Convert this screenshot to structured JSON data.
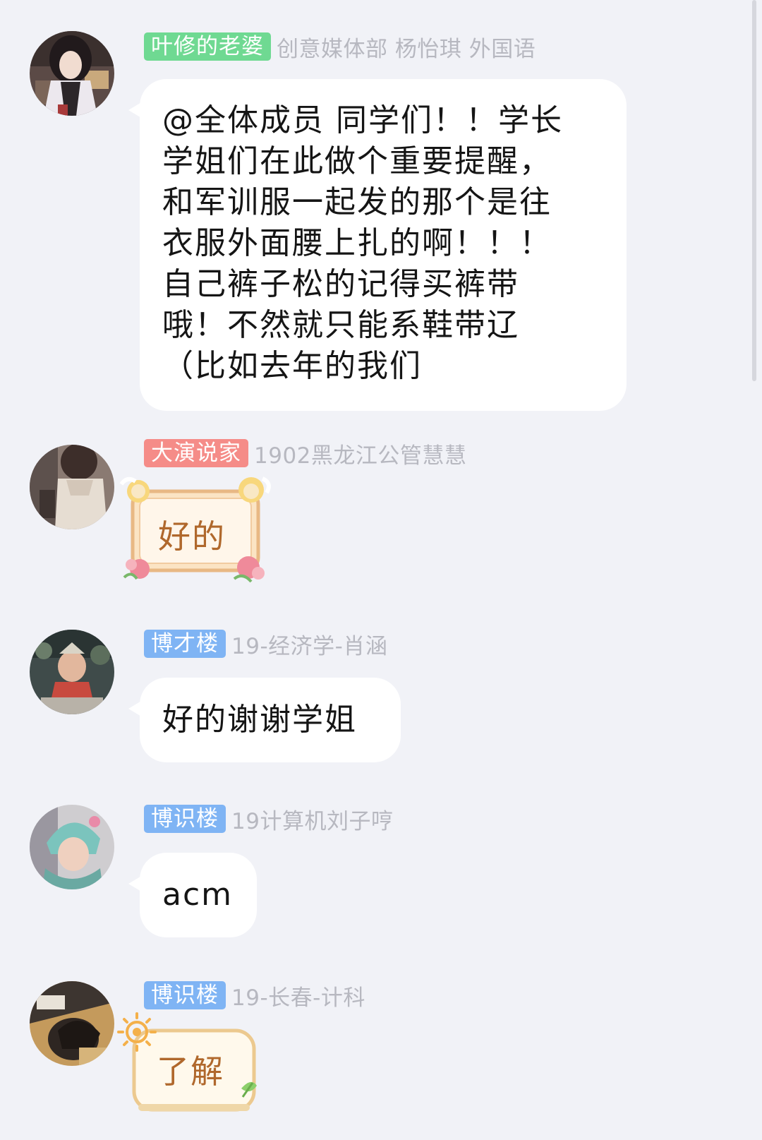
{
  "messages": [
    {
      "badge": "叶修的老婆",
      "badge_color": "#6fd992",
      "sender": "创意媒体部 杨怡琪 外国语",
      "lines": [
        "@全体成员 同学们！！学长",
        "学姐们在此做个重要提醒，",
        "和军训服一起发的那个是往",
        "衣服外面腰上扎的啊！！！",
        "自己裤子松的记得买裤带",
        "哦！不然就只能系鞋带辽",
        "（比如去年的我们"
      ]
    },
    {
      "badge": "大演说家",
      "badge_color": "#f58c88",
      "sender": "1902黑龙江公管慧慧",
      "sticker_text": "好的"
    },
    {
      "badge": "博才楼",
      "badge_color": "#7fb4f4",
      "sender": "19-经济学-肖涵",
      "text": "好的谢谢学姐"
    },
    {
      "badge": "博识楼",
      "badge_color": "#7fb4f4",
      "sender": "19计算机刘子哼",
      "text": "acm"
    },
    {
      "badge": "博识楼",
      "badge_color": "#7fb4f4",
      "sender": "19-长春-计科",
      "sticker_text": "了解"
    }
  ]
}
